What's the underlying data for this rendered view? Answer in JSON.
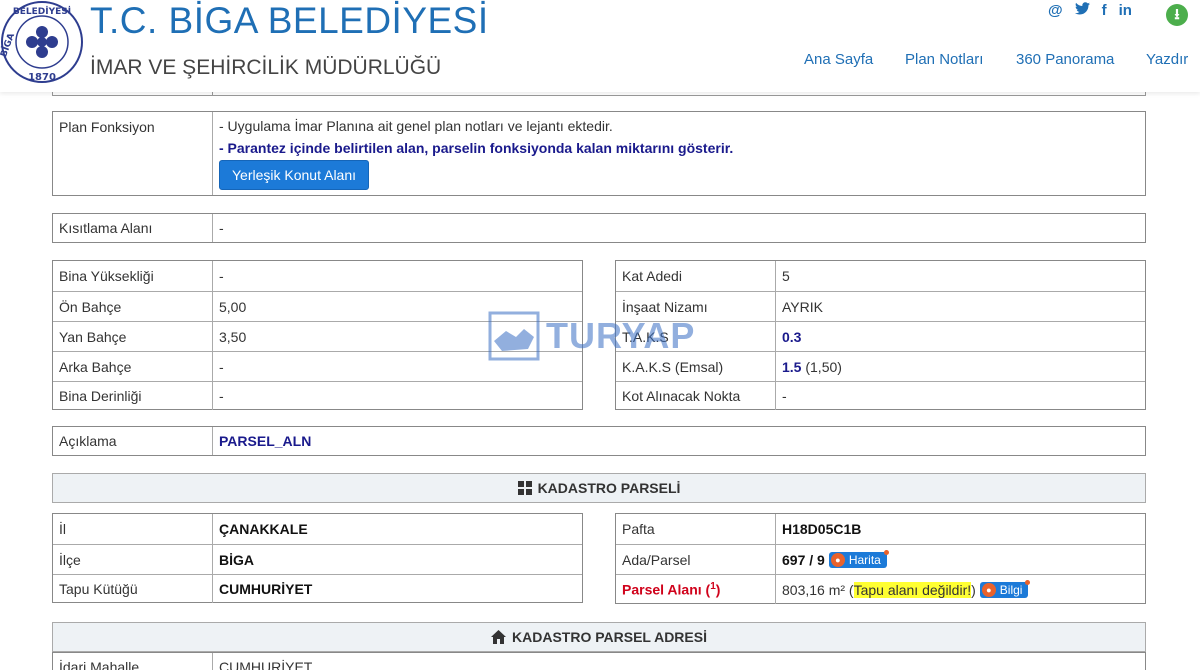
{
  "header": {
    "logo_text": "BİGA BELEDİYESİ 1870",
    "title": "T.C. BİGA BELEDİYESİ",
    "subtitle": "İMAR VE ŞEHİRCİLİK MÜDÜRLÜĞÜ",
    "social": [
      "@",
      "twitter",
      "f",
      "in"
    ],
    "nav": [
      "Ana Sayfa",
      "Plan Notları",
      "360 Panorama",
      "Yazdır"
    ]
  },
  "plan": {
    "label": "Plan Fonksiyon",
    "note1": "- Uygulama İmar Planına ait genel plan notları ve lejantı ektedir.",
    "note2": "- Parantez içinde belirtilen alan, parselin fonksiyonda kalan miktarını gösterir.",
    "button": "Yerleşik Konut Alanı"
  },
  "kisitlama": {
    "label": "Kısıtlama Alanı",
    "value": "-"
  },
  "left_table": [
    {
      "label": "Bina Yüksekliği",
      "value": "-"
    },
    {
      "label": "Ön Bahçe",
      "value": "5,00"
    },
    {
      "label": "Yan Bahçe",
      "value": "3,50"
    },
    {
      "label": "Arka Bahçe",
      "value": "-"
    },
    {
      "label": "Bina Derinliği",
      "value": "-"
    }
  ],
  "right_table": [
    {
      "label": "Kat Adedi",
      "value": "5"
    },
    {
      "label": "İnşaat Nizamı",
      "value": "AYRIK"
    },
    {
      "label": "T.A.K.S",
      "value": "0.3"
    },
    {
      "label": "K.A.K.S (Emsal)",
      "value": "1.5",
      "extra": " (1,50)"
    },
    {
      "label": "Kot Alınacak Nokta",
      "value": "-"
    }
  ],
  "aciklama": {
    "label": "Açıklama",
    "value": "PARSEL_ALN"
  },
  "kadastro": {
    "heading": "KADASTRO PARSELİ",
    "left": [
      {
        "label": "İl",
        "value": "ÇANAKKALE"
      },
      {
        "label": "İlçe",
        "value": "BİGA"
      },
      {
        "label": "Tapu Kütüğü",
        "value": "CUMHURİYET"
      }
    ],
    "pafta": {
      "label": "Pafta",
      "value": "H18D05C1B"
    },
    "ada": {
      "label": "Ada/Parsel",
      "value": "697 / 9",
      "button": "Harita"
    },
    "alan": {
      "label": "Parsel Alanı (",
      "sup": "1",
      "label_end": ")",
      "value": "803,16 m² (",
      "highlight": "Tapu alanı değildir!",
      "value_end": ")",
      "button": "Bilgi"
    }
  },
  "adres": {
    "heading": "KADASTRO PARSEL ADRESİ",
    "row_label": "İdari Mahalle",
    "row_value": "CUMHURİYET"
  },
  "watermark": "TURYAP"
}
